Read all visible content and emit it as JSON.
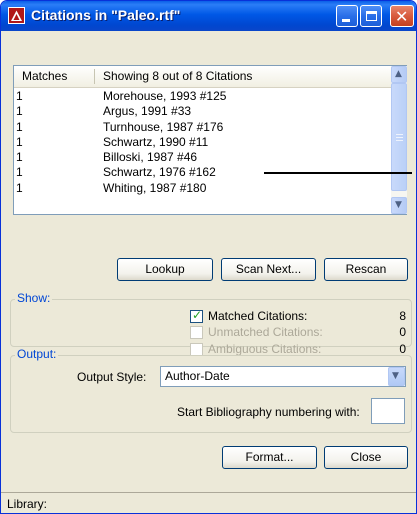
{
  "window": {
    "title": "Citations in \"Paleo.rtf\""
  },
  "list": {
    "columns": [
      "Matches",
      "Showing 8 out of 8 Citations"
    ],
    "rows": [
      {
        "matches": "1",
        "citation": "Morehouse, 1993 #125"
      },
      {
        "matches": "1",
        "citation": "Argus, 1991 #33"
      },
      {
        "matches": "1",
        "citation": "Turnhouse, 1987 #176"
      },
      {
        "matches": "1",
        "citation": "Schwartz, 1990 #11"
      },
      {
        "matches": "1",
        "citation": "Billoski, 1987 #46"
      },
      {
        "matches": "1",
        "citation": "Schwartz, 1976 #162"
      },
      {
        "matches": "1",
        "citation": "Whiting, 1987 #180"
      }
    ]
  },
  "actions": {
    "lookup": "Lookup",
    "scan_next": "Scan Next...",
    "rescan": "Rescan"
  },
  "show": {
    "title": "Show:",
    "matched": {
      "label": "Matched Citations:",
      "count": "8",
      "checked": true
    },
    "unmatched": {
      "label": "Unmatched Citations:",
      "count": "0",
      "checked": false
    },
    "ambiguous": {
      "label": "Ambiguous Citations:",
      "count": "0",
      "checked": false
    }
  },
  "output": {
    "title": "Output:",
    "style_label": "Output Style:",
    "style_value": "Author-Date",
    "numbering_label": "Start Bibliography numbering with:",
    "numbering_value": ""
  },
  "footer": {
    "format": "Format...",
    "close": "Close"
  },
  "status": {
    "text": "Library:"
  },
  "colors": {
    "titlebar": "#0058e6",
    "group_title": "#0046d5",
    "check": "#21a121"
  }
}
